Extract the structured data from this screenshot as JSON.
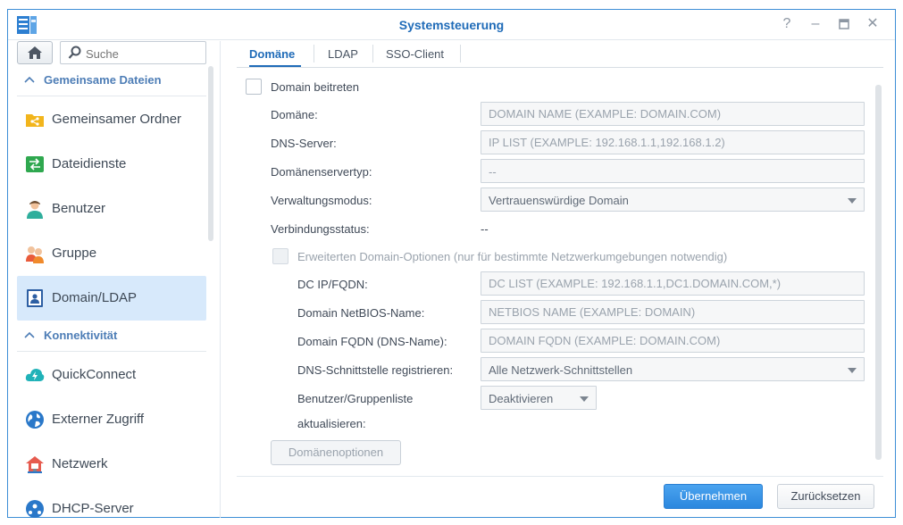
{
  "window": {
    "title": "Systemsteuerung",
    "controls": [
      "help-icon",
      "minimize-icon",
      "maximize-icon",
      "close-icon"
    ]
  },
  "sidebar": {
    "search_placeholder": "Suche",
    "sections": [
      {
        "label": "Gemeinsame Dateien",
        "items": [
          {
            "label": "Gemeinsamer Ordner",
            "icon": "shared-folder-icon"
          },
          {
            "label": "Dateidienste",
            "icon": "file-services-icon"
          },
          {
            "label": "Benutzer",
            "icon": "user-icon"
          },
          {
            "label": "Gruppe",
            "icon": "group-icon"
          },
          {
            "label": "Domain/LDAP",
            "icon": "domain-ldap-icon",
            "active": true
          }
        ]
      },
      {
        "label": "Konnektivität",
        "items": [
          {
            "label": "QuickConnect",
            "icon": "quickconnect-icon"
          },
          {
            "label": "Externer Zugriff",
            "icon": "external-access-icon"
          },
          {
            "label": "Netzwerk",
            "icon": "network-icon"
          },
          {
            "label": "DHCP-Server",
            "icon": "dhcp-server-icon"
          }
        ]
      }
    ]
  },
  "tabs": [
    {
      "label": "Domäne",
      "active": true
    },
    {
      "label": "LDAP",
      "active": false
    },
    {
      "label": "SSO-Client",
      "active": false
    }
  ],
  "form": {
    "join_domain_label": "Domain beitreten",
    "domain_label": "Domäne:",
    "domain_placeholder": "DOMAIN NAME (EXAMPLE: DOMAIN.COM)",
    "dns_label": "DNS-Server:",
    "dns_placeholder": "IP LIST (EXAMPLE: 192.168.1.1,192.168.1.2)",
    "server_type_label": "Domänenservertyp:",
    "server_type_value": "--",
    "mgmt_mode_label": "Verwaltungsmodus:",
    "mgmt_mode_value": "Vertrauenswürdige Domain",
    "conn_status_label": "Verbindungsstatus:",
    "conn_status_value": "--",
    "advanced_label": "Erweiterten Domain-Optionen (nur für bestimmte Netzwerkumgebungen notwendig)",
    "dc_label": "DC IP/FQDN:",
    "dc_placeholder": "DC LIST (EXAMPLE: 192.168.1.1,DC1.DOMAIN.COM,*)",
    "netbios_label": "Domain NetBIOS-Name:",
    "netbios_placeholder": "NETBIOS NAME (EXAMPLE: DOMAIN)",
    "fqdn_label": "Domain FQDN (DNS-Name):",
    "fqdn_placeholder": "DOMAIN FQDN (EXAMPLE: DOMAIN.COM)",
    "dns_iface_label": "DNS-Schnittstelle registrieren:",
    "dns_iface_value": "Alle Netzwerk-Schnittstellen",
    "userlist_label_1": "Benutzer/Gruppenliste",
    "userlist_label_2": "aktualisieren:",
    "userlist_value": "Deaktivieren",
    "domain_options_button": "Domänenoptionen"
  },
  "footer": {
    "apply_button": "Übernehmen",
    "reset_button": "Zurücksetzen"
  },
  "colors": {
    "accent": "#1f6bb8",
    "active_nav": "#d7e9fb",
    "primary_button": "#2b87de"
  }
}
